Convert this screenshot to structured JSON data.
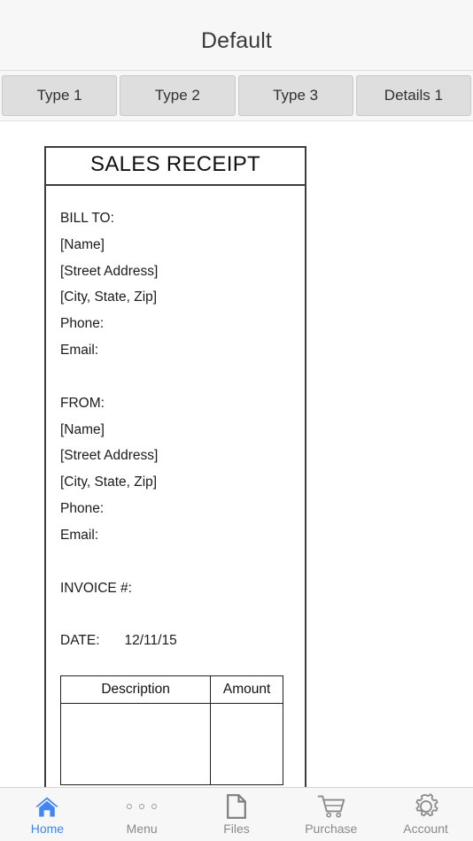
{
  "header": {
    "title": "Default"
  },
  "tabs": [
    {
      "label": "Type 1",
      "name": "tab-type-1"
    },
    {
      "label": "Type 2",
      "name": "tab-type-2"
    },
    {
      "label": "Type 3",
      "name": "tab-type-3"
    },
    {
      "label": "Details 1",
      "name": "tab-details-1"
    }
  ],
  "receipt": {
    "title": "SALES RECEIPT",
    "bill_to": {
      "heading": "BILL TO:",
      "name": "[Name]",
      "street": "[Street Address]",
      "city_state_zip": "[City, State, Zip]",
      "phone": "Phone:",
      "email": "Email:"
    },
    "from": {
      "heading": "FROM:",
      "name": "[Name]",
      "street": "[Street Address]",
      "city_state_zip": "[City, State, Zip]",
      "phone": "Phone:",
      "email": "Email:"
    },
    "invoice_label": "INVOICE #:",
    "invoice_value": "",
    "date_label": "DATE:",
    "date_value": "12/11/15",
    "table": {
      "headers": [
        "Description",
        "Amount"
      ],
      "rows": [
        {
          "description": "",
          "amount": ""
        }
      ]
    }
  },
  "bottom_nav": {
    "active_index": 0,
    "active_color": "#4285f4",
    "inactive_color": "#8a8a8a",
    "items": [
      {
        "label": "Home",
        "icon": "home-icon"
      },
      {
        "label": "Menu",
        "icon": "menu-dots-icon"
      },
      {
        "label": "Files",
        "icon": "file-icon"
      },
      {
        "label": "Purchase",
        "icon": "shopping-cart-icon"
      },
      {
        "label": "Account",
        "icon": "gear-icon"
      }
    ]
  }
}
